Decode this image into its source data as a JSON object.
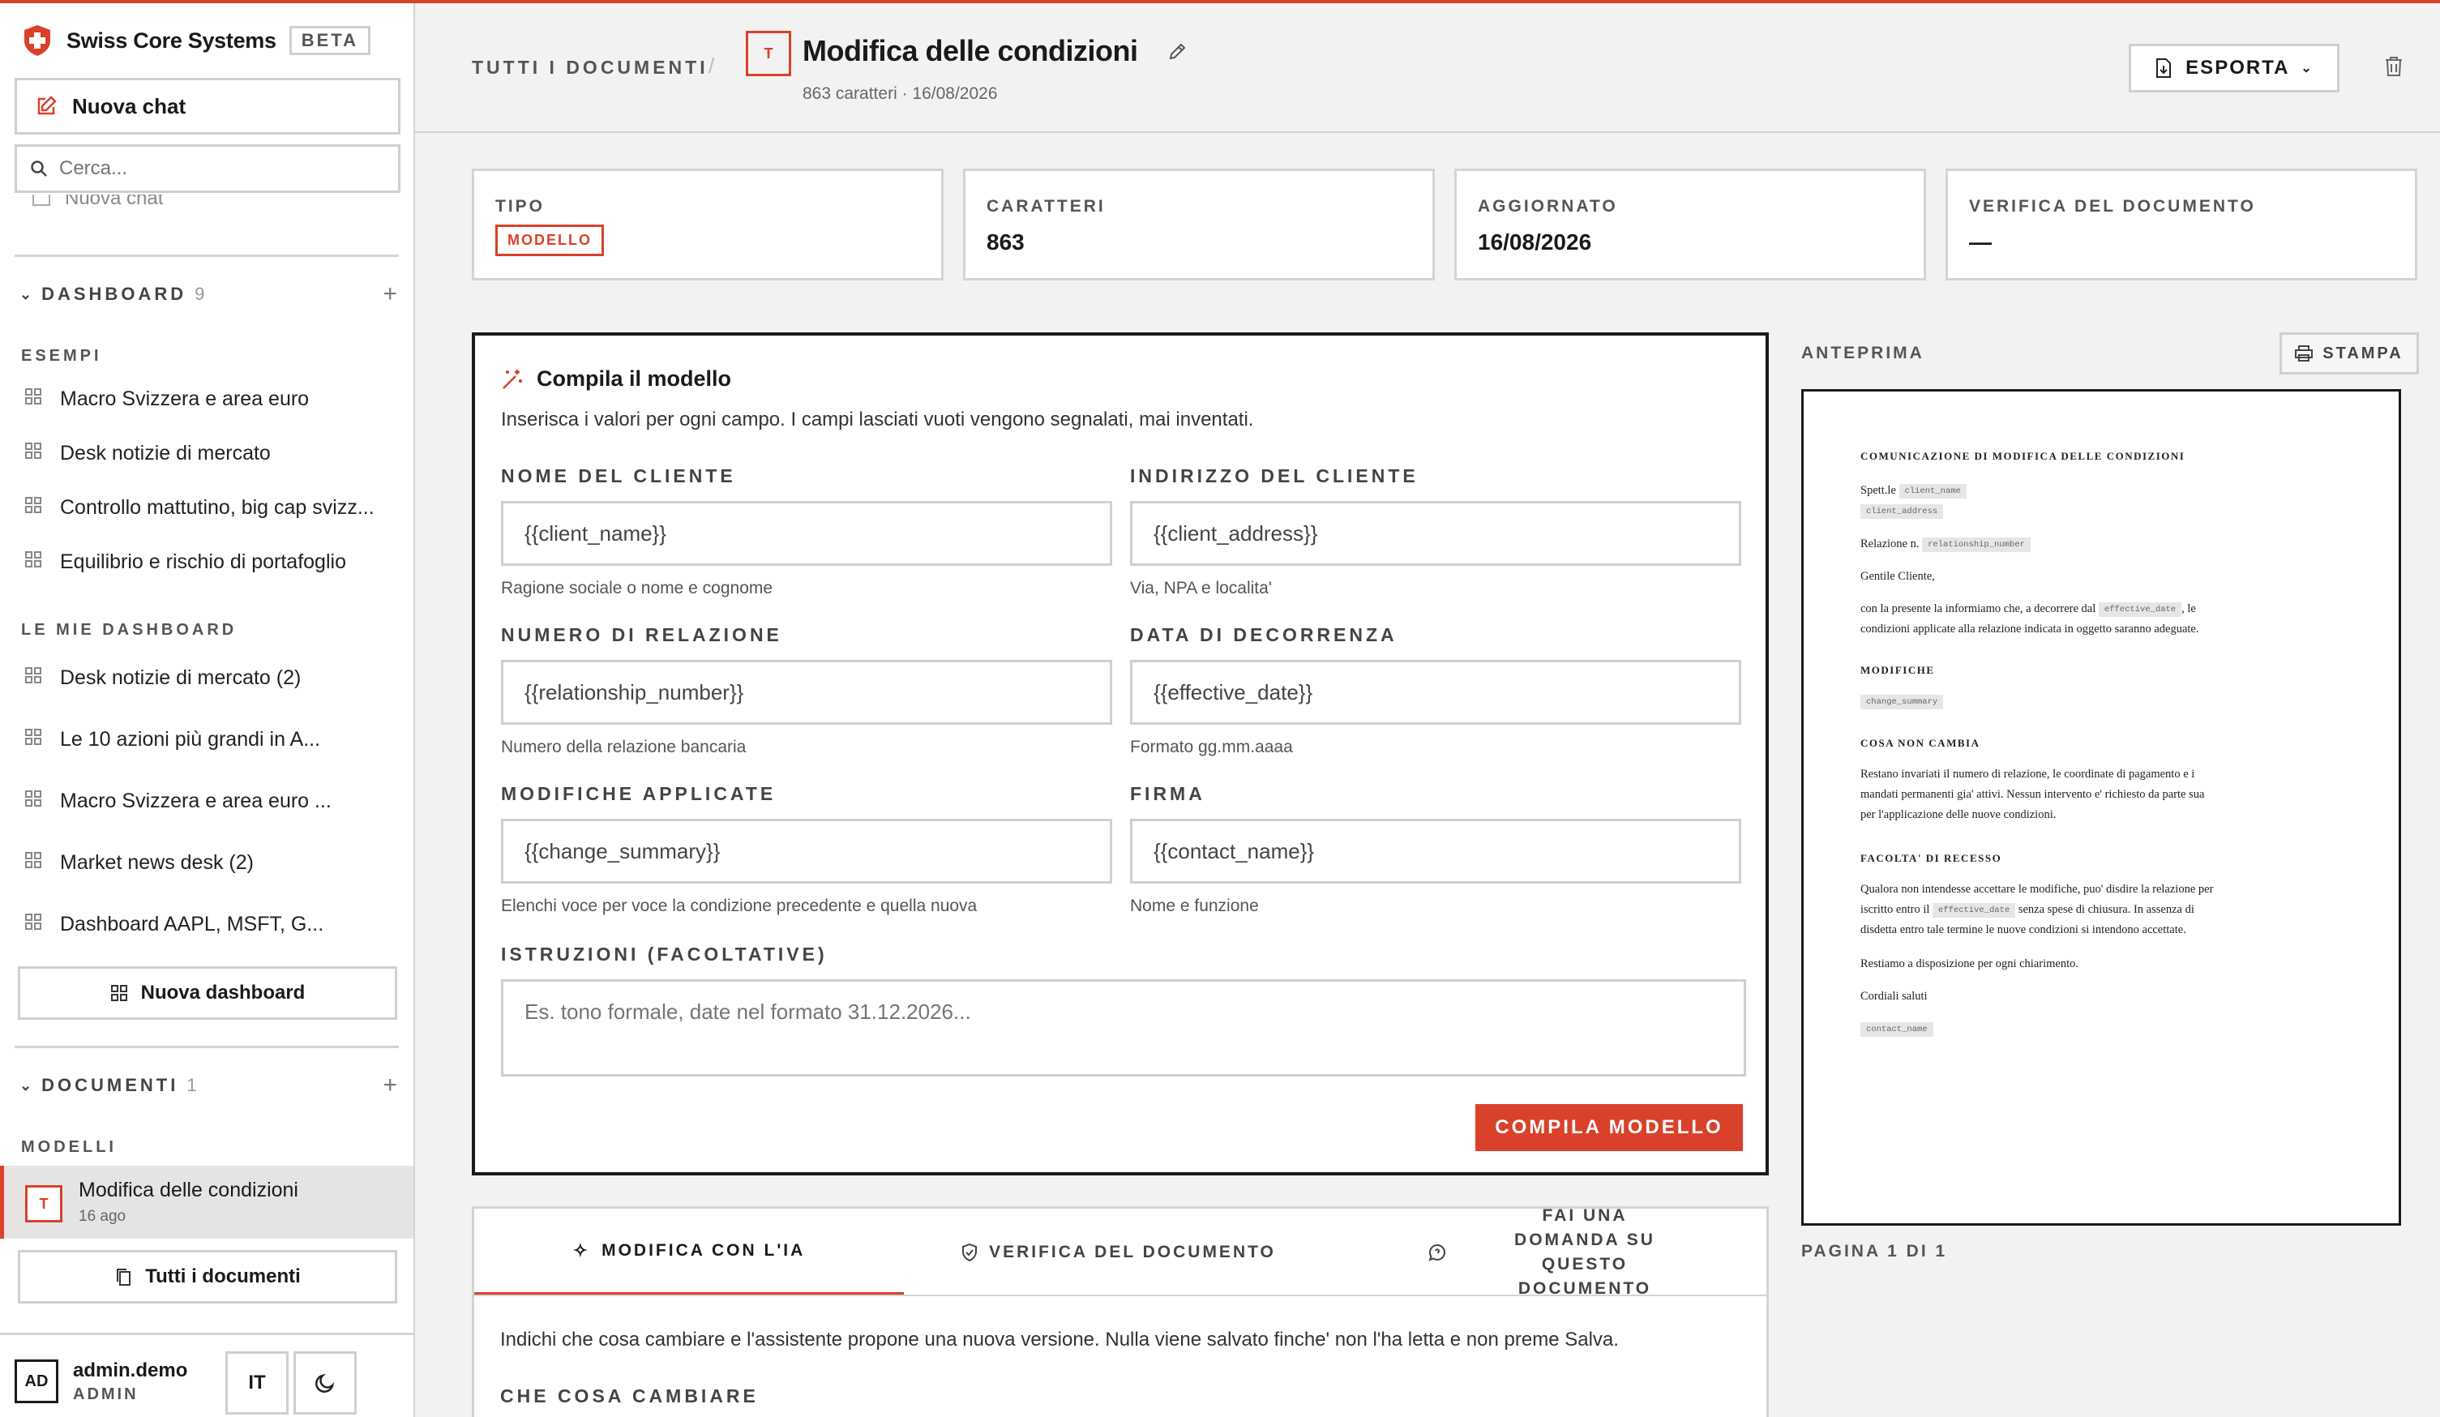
{
  "colors": {
    "accent": "#d9412b",
    "text": "#1a1a1a",
    "border": "#cfcfcf",
    "bg": "#f2f2f2"
  },
  "sidebar": {
    "brand": "Swiss Core Systems",
    "beta": "BETA",
    "new_chat": "Nuova chat",
    "search_placeholder": "Cerca...",
    "recent_chat": "Nuova chat",
    "dashboard_section": {
      "label": "DASHBOARD",
      "count": "9"
    },
    "examples_label": "ESEMPI",
    "examples": [
      "Macro Svizzera e area euro",
      "Desk notizie di mercato",
      "Controllo mattutino, big cap svizz...",
      "Equilibrio e rischio di portafoglio"
    ],
    "my_label": "LE MIE DASHBOARD",
    "my_dashboards": [
      "Desk notizie di mercato (2)",
      "Le 10 azioni più grandi in A...",
      "Macro Svizzera e area euro ...",
      "Market news desk (2)",
      "Dashboard AAPL, MSFT, G..."
    ],
    "new_dashboard": "Nuova dashboard",
    "documents_section": {
      "label": "DOCUMENTI",
      "count": "1"
    },
    "models_label": "MODELLI",
    "doc": {
      "icon": "T",
      "title": "Modifica delle condizioni",
      "time": "16 ago"
    },
    "all_docs": "Tutti i documenti",
    "user": {
      "initials": "AD",
      "name": "admin.demo",
      "role": "ADMIN"
    },
    "lang": "IT"
  },
  "header": {
    "breadcrumb": "TUTTI I DOCUMENTI",
    "doc_icon": "T",
    "title": "Modifica delle condizioni",
    "subtitle": "863 caratteri · 16/08/2026",
    "export": "ESPORTA"
  },
  "cards": [
    {
      "label": "TIPO",
      "badge": "MODELLO"
    },
    {
      "label": "CARATTERI",
      "value": "863"
    },
    {
      "label": "AGGIORNATO",
      "value": "16/08/2026"
    },
    {
      "label": "VERIFICA DEL DOCUMENTO",
      "value": "—"
    }
  ],
  "form": {
    "title": "Compila il modello",
    "desc": "Inserisca i valori per ogni campo. I campi lasciati vuoti vengono segnalati, mai inventati.",
    "fields": [
      {
        "label": "NOME DEL CLIENTE",
        "value": "{{client_name}}",
        "hint": "Ragione sociale o nome e cognome"
      },
      {
        "label": "INDIRIZZO DEL CLIENTE",
        "value": "{{client_address}}",
        "hint": "Via, NPA e localita'"
      },
      {
        "label": "NUMERO DI RELAZIONE",
        "value": "{{relationship_number}}",
        "hint": "Numero della relazione bancaria"
      },
      {
        "label": "DATA DI DECORRENZA",
        "value": "{{effective_date}}",
        "hint": "Formato gg.mm.aaaa"
      },
      {
        "label": "MODIFICHE APPLICATE",
        "value": "{{change_summary}}",
        "hint": "Elenchi voce per voce la condizione precedente e quella nuova"
      },
      {
        "label": "FIRMA",
        "value": "{{contact_name}}",
        "hint": "Nome e funzione"
      }
    ],
    "instructions_label": "ISTRUZIONI (FACOLTATIVE)",
    "instructions_placeholder": "Es. tono formale, date nel formato 31.12.2026...",
    "submit": "COMPILA MODELLO"
  },
  "tabs": {
    "items": [
      "MODIFICA CON L'IA",
      "VERIFICA DEL DOCUMENTO",
      "FAI UNA DOMANDA SU QUESTO DOCUMENTO"
    ],
    "active": 0,
    "desc": "Indichi che cosa cambiare e l'assistente propone una nuova versione. Nulla viene salvato finche' non l'ha letta e non preme Salva.",
    "change_label": "CHE COSA CAMBIARE"
  },
  "preview": {
    "label": "ANTEPRIMA",
    "print": "STAMPA",
    "page": "PAGINA 1 DI 1",
    "doc": {
      "heading": "COMUNICAZIONE DI MODIFICA DELLE CONDIZIONI",
      "salutation": "Spett.le",
      "tok_name": "client_name",
      "tok_address": "client_address",
      "relation": "Relazione n.",
      "tok_relation": "relationship_number",
      "greeting": "Gentile Cliente,",
      "intro_a": "con la presente la informiamo che, a decorrere dal",
      "tok_date": "effective_date",
      "intro_b": ", le",
      "intro_c": "condizioni applicate alla relazione indicata in oggetto saranno adeguate.",
      "h_changes": "MODIFICHE",
      "tok_changes": "change_summary",
      "h_unchanged": "COSA NON CAMBIA",
      "unchanged_1": "Restano invariati il numero di relazione, le coordinate di pagamento e i",
      "unchanged_2": "mandati permanenti gia' attivi. Nessun intervento e' richiesto da parte sua",
      "unchanged_3": "per l'applicazione delle nuove condizioni.",
      "h_withdraw": "FACOLTA' DI RECESSO",
      "withdraw_1": "Qualora non intendesse accettare le modifiche, puo' disdire la relazione per",
      "withdraw_2a": "iscritto entro il",
      "withdraw_2b": "senza spese di chiusura. In assenza di",
      "withdraw_3": "disdetta entro tale termine le nuove condizioni si intendono accettate.",
      "closing_1": "Restiamo a disposizione per ogni chiarimento.",
      "closing_2": "Cordiali saluti",
      "tok_contact": "contact_name"
    }
  }
}
